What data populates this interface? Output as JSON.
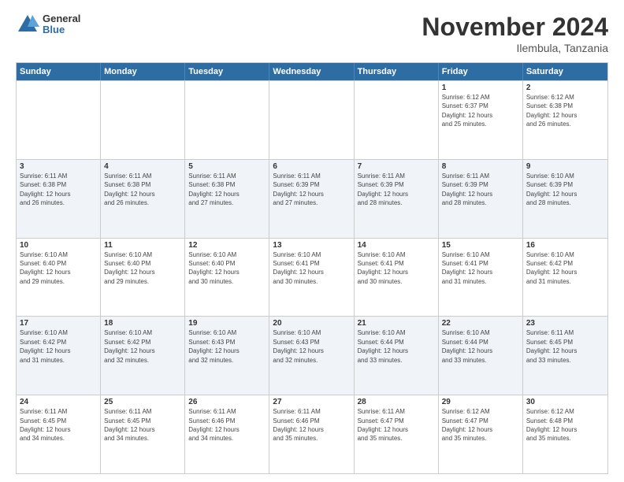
{
  "header": {
    "logo": {
      "general": "General",
      "blue": "Blue"
    },
    "title": "November 2024",
    "location": "Ilembula, Tanzania"
  },
  "calendar": {
    "days_of_week": [
      "Sunday",
      "Monday",
      "Tuesday",
      "Wednesday",
      "Thursday",
      "Friday",
      "Saturday"
    ],
    "weeks": [
      [
        {
          "day": "",
          "data": []
        },
        {
          "day": "",
          "data": []
        },
        {
          "day": "",
          "data": []
        },
        {
          "day": "",
          "data": []
        },
        {
          "day": "",
          "data": []
        },
        {
          "day": "1",
          "data": [
            "Sunrise: 6:12 AM",
            "Sunset: 6:37 PM",
            "Daylight: 12 hours",
            "and 25 minutes."
          ]
        },
        {
          "day": "2",
          "data": [
            "Sunrise: 6:12 AM",
            "Sunset: 6:38 PM",
            "Daylight: 12 hours",
            "and 26 minutes."
          ]
        }
      ],
      [
        {
          "day": "3",
          "data": [
            "Sunrise: 6:11 AM",
            "Sunset: 6:38 PM",
            "Daylight: 12 hours",
            "and 26 minutes."
          ]
        },
        {
          "day": "4",
          "data": [
            "Sunrise: 6:11 AM",
            "Sunset: 6:38 PM",
            "Daylight: 12 hours",
            "and 26 minutes."
          ]
        },
        {
          "day": "5",
          "data": [
            "Sunrise: 6:11 AM",
            "Sunset: 6:38 PM",
            "Daylight: 12 hours",
            "and 27 minutes."
          ]
        },
        {
          "day": "6",
          "data": [
            "Sunrise: 6:11 AM",
            "Sunset: 6:39 PM",
            "Daylight: 12 hours",
            "and 27 minutes."
          ]
        },
        {
          "day": "7",
          "data": [
            "Sunrise: 6:11 AM",
            "Sunset: 6:39 PM",
            "Daylight: 12 hours",
            "and 28 minutes."
          ]
        },
        {
          "day": "8",
          "data": [
            "Sunrise: 6:11 AM",
            "Sunset: 6:39 PM",
            "Daylight: 12 hours",
            "and 28 minutes."
          ]
        },
        {
          "day": "9",
          "data": [
            "Sunrise: 6:10 AM",
            "Sunset: 6:39 PM",
            "Daylight: 12 hours",
            "and 28 minutes."
          ]
        }
      ],
      [
        {
          "day": "10",
          "data": [
            "Sunrise: 6:10 AM",
            "Sunset: 6:40 PM",
            "Daylight: 12 hours",
            "and 29 minutes."
          ]
        },
        {
          "day": "11",
          "data": [
            "Sunrise: 6:10 AM",
            "Sunset: 6:40 PM",
            "Daylight: 12 hours",
            "and 29 minutes."
          ]
        },
        {
          "day": "12",
          "data": [
            "Sunrise: 6:10 AM",
            "Sunset: 6:40 PM",
            "Daylight: 12 hours",
            "and 30 minutes."
          ]
        },
        {
          "day": "13",
          "data": [
            "Sunrise: 6:10 AM",
            "Sunset: 6:41 PM",
            "Daylight: 12 hours",
            "and 30 minutes."
          ]
        },
        {
          "day": "14",
          "data": [
            "Sunrise: 6:10 AM",
            "Sunset: 6:41 PM",
            "Daylight: 12 hours",
            "and 30 minutes."
          ]
        },
        {
          "day": "15",
          "data": [
            "Sunrise: 6:10 AM",
            "Sunset: 6:41 PM",
            "Daylight: 12 hours",
            "and 31 minutes."
          ]
        },
        {
          "day": "16",
          "data": [
            "Sunrise: 6:10 AM",
            "Sunset: 6:42 PM",
            "Daylight: 12 hours",
            "and 31 minutes."
          ]
        }
      ],
      [
        {
          "day": "17",
          "data": [
            "Sunrise: 6:10 AM",
            "Sunset: 6:42 PM",
            "Daylight: 12 hours",
            "and 31 minutes."
          ]
        },
        {
          "day": "18",
          "data": [
            "Sunrise: 6:10 AM",
            "Sunset: 6:42 PM",
            "Daylight: 12 hours",
            "and 32 minutes."
          ]
        },
        {
          "day": "19",
          "data": [
            "Sunrise: 6:10 AM",
            "Sunset: 6:43 PM",
            "Daylight: 12 hours",
            "and 32 minutes."
          ]
        },
        {
          "day": "20",
          "data": [
            "Sunrise: 6:10 AM",
            "Sunset: 6:43 PM",
            "Daylight: 12 hours",
            "and 32 minutes."
          ]
        },
        {
          "day": "21",
          "data": [
            "Sunrise: 6:10 AM",
            "Sunset: 6:44 PM",
            "Daylight: 12 hours",
            "and 33 minutes."
          ]
        },
        {
          "day": "22",
          "data": [
            "Sunrise: 6:10 AM",
            "Sunset: 6:44 PM",
            "Daylight: 12 hours",
            "and 33 minutes."
          ]
        },
        {
          "day": "23",
          "data": [
            "Sunrise: 6:11 AM",
            "Sunset: 6:45 PM",
            "Daylight: 12 hours",
            "and 33 minutes."
          ]
        }
      ],
      [
        {
          "day": "24",
          "data": [
            "Sunrise: 6:11 AM",
            "Sunset: 6:45 PM",
            "Daylight: 12 hours",
            "and 34 minutes."
          ]
        },
        {
          "day": "25",
          "data": [
            "Sunrise: 6:11 AM",
            "Sunset: 6:45 PM",
            "Daylight: 12 hours",
            "and 34 minutes."
          ]
        },
        {
          "day": "26",
          "data": [
            "Sunrise: 6:11 AM",
            "Sunset: 6:46 PM",
            "Daylight: 12 hours",
            "and 34 minutes."
          ]
        },
        {
          "day": "27",
          "data": [
            "Sunrise: 6:11 AM",
            "Sunset: 6:46 PM",
            "Daylight: 12 hours",
            "and 35 minutes."
          ]
        },
        {
          "day": "28",
          "data": [
            "Sunrise: 6:11 AM",
            "Sunset: 6:47 PM",
            "Daylight: 12 hours",
            "and 35 minutes."
          ]
        },
        {
          "day": "29",
          "data": [
            "Sunrise: 6:12 AM",
            "Sunset: 6:47 PM",
            "Daylight: 12 hours",
            "and 35 minutes."
          ]
        },
        {
          "day": "30",
          "data": [
            "Sunrise: 6:12 AM",
            "Sunset: 6:48 PM",
            "Daylight: 12 hours",
            "and 35 minutes."
          ]
        }
      ]
    ]
  }
}
